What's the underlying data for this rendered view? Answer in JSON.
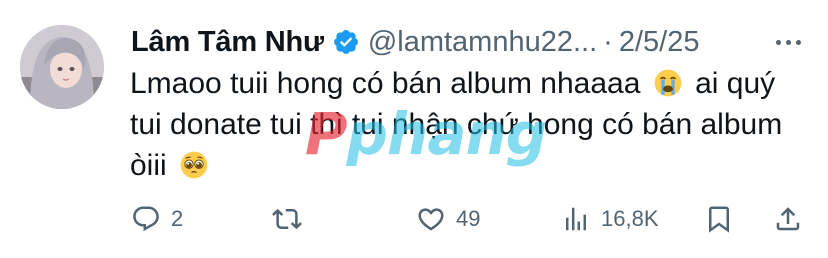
{
  "tweet": {
    "author_name": "Lâm Tâm Như",
    "handle": "@lamtamnhu22...",
    "separator": "·",
    "date": "2/5/25",
    "text_part1": "Lmaoo tuii hong có bán album nhaaaa",
    "text_part2": "ai quý tui donate tui thì tui nhận chứ hong có bán album òiii",
    "emoji_1": "loudly-crying-face",
    "emoji_2": "pleading-face"
  },
  "watermark": {
    "lead": "P",
    "rest": "phang"
  },
  "actions": {
    "reply_count": "2",
    "repost_count": "",
    "like_count": "49",
    "views_count": "16,8K"
  },
  "colors": {
    "text": "#0f1419",
    "secondary": "#536471",
    "verified": "#1d9bf0",
    "watermark_blue": "#21bfe4",
    "watermark_red": "#e62832"
  }
}
